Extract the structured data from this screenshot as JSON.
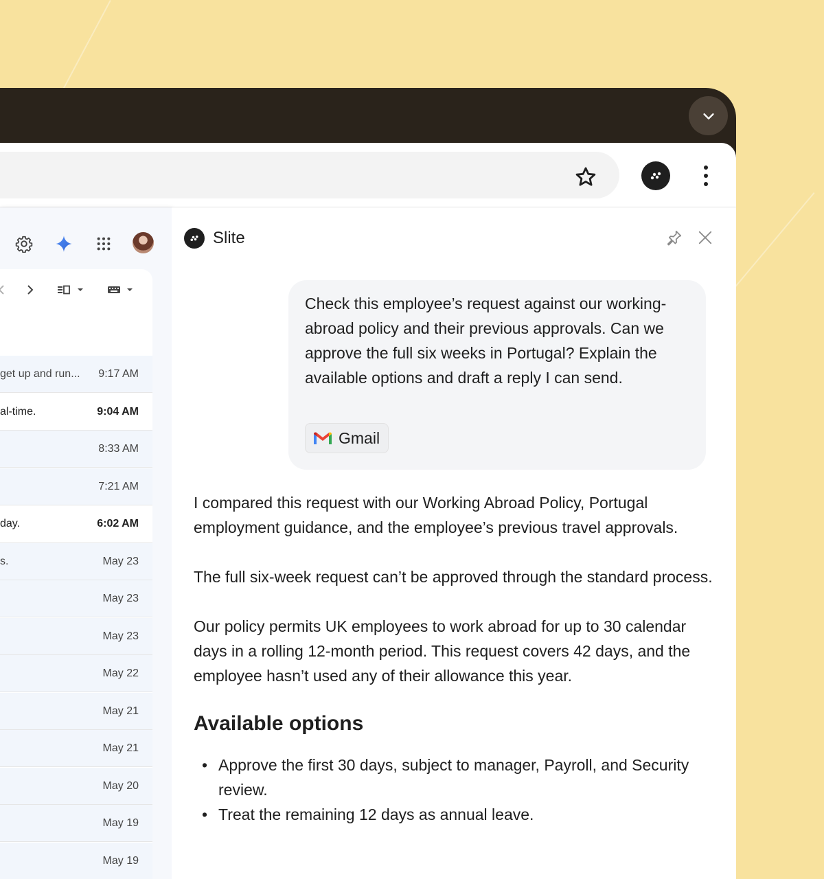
{
  "gmail": {
    "emails": [
      {
        "snippet": "get up and run...",
        "time": "9:17 AM",
        "unread": false
      },
      {
        "snippet": "al-time.",
        "time": "9:04 AM",
        "unread": true
      },
      {
        "snippet": "",
        "time": "8:33 AM",
        "unread": false
      },
      {
        "snippet": "",
        "time": "7:21 AM",
        "unread": false
      },
      {
        "snippet": "day.",
        "time": "6:02 AM",
        "unread": true
      },
      {
        "snippet": "s.",
        "time": "May 23",
        "unread": false
      },
      {
        "snippet": "",
        "time": "May 23",
        "unread": false
      },
      {
        "snippet": "",
        "time": "May 23",
        "unread": false
      },
      {
        "snippet": "",
        "time": "May 22",
        "unread": false
      },
      {
        "snippet": "",
        "time": "May 21",
        "unread": false
      },
      {
        "snippet": "",
        "time": "May 21",
        "unread": false
      },
      {
        "snippet": "",
        "time": "May 20",
        "unread": false
      },
      {
        "snippet": "",
        "time": "May 19",
        "unread": false
      },
      {
        "snippet": "",
        "time": "May 19",
        "unread": false
      }
    ]
  },
  "slite": {
    "title": "Slite",
    "prompt": "Check this employee’s request against our working-abroad policy and their previous approvals. Can we approve the full six weeks in Portugal? Explain the available options and draft a reply I can send.",
    "attachment_label": "Gmail",
    "answer": {
      "p1": "I compared this request with our Working Abroad Policy, Portugal employment guidance, and the employee’s previous travel approvals.",
      "p2": "The full six-week request can’t be approved through the standard process.",
      "p3": "Our policy permits UK employees to work abroad for up to 30 calendar days in a rolling 12-month period. This request covers 42 days, and the employee hasn’t used any of their allowance this year.",
      "heading": "Available options",
      "options": [
        "Approve the first 30 days, subject to manager, Payroll, and Security review.",
        "Treat the remaining 12 days as annual leave."
      ]
    }
  }
}
